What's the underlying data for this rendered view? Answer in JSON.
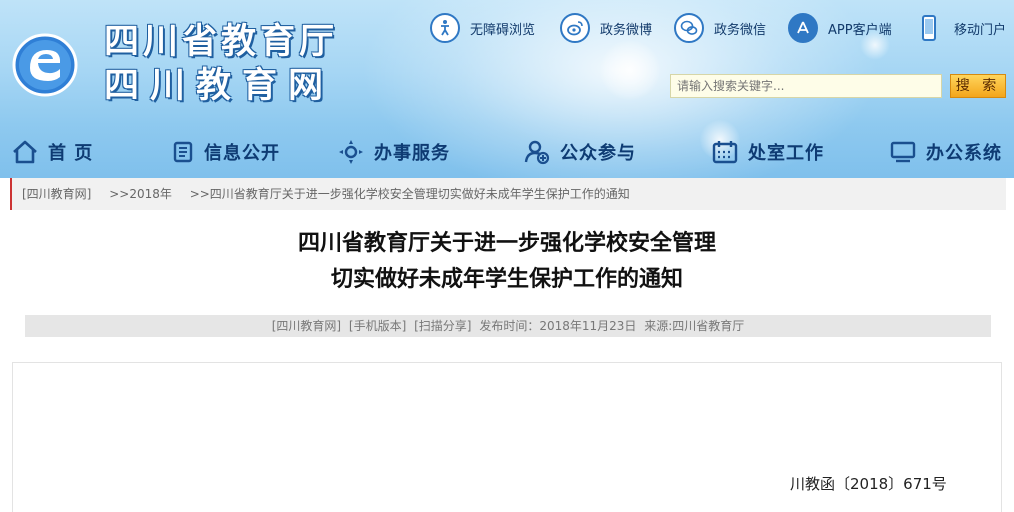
{
  "header": {
    "site_name_line1": "四川省教育厅",
    "site_name_line2": "四川教育网",
    "top_links": [
      {
        "label": "无障碍浏览",
        "icon": "accessibility-icon"
      },
      {
        "label": "政务微博",
        "icon": "weibo-icon"
      },
      {
        "label": "政务微信",
        "icon": "wechat-icon"
      },
      {
        "label": "APP客户端",
        "icon": "app-store-icon"
      },
      {
        "label": "移动门户",
        "icon": "mobile-phone-icon"
      }
    ],
    "search": {
      "placeholder": "请输入搜索关键字...",
      "button_label": "搜 索"
    }
  },
  "nav": [
    {
      "label": "首 页",
      "icon": "home-icon"
    },
    {
      "label": "信息公开",
      "icon": "document-list-icon"
    },
    {
      "label": "办事服务",
      "icon": "service-compass-icon"
    },
    {
      "label": "公众参与",
      "icon": "user-add-icon"
    },
    {
      "label": "处室工作",
      "icon": "calendar-icon"
    },
    {
      "label": "办公系统",
      "icon": "monitor-icon"
    }
  ],
  "breadcrumb": {
    "home": "[四川教育网]",
    "year": ">>2018年",
    "current": ">>四川省教育厅关于进一步强化学校安全管理切实做好未成年学生保护工作的通知"
  },
  "article": {
    "title_line1": "四川省教育厅关于进一步强化学校安全管理",
    "title_line2": "切实做好未成年学生保护工作的通知",
    "meta": {
      "source_site": "[四川教育网]",
      "mobile_version": "[手机版本]",
      "scan_share": "[扫描分享]",
      "publish_time": "发布时间：2018年11月23日",
      "origin": "来源:四川省教育厅"
    },
    "doc_number": "川教函〔2018〕671号"
  },
  "colors": {
    "header_sky": "#8ec9ef",
    "nav_text": "#0e3b73",
    "search_button": "#f3a51b",
    "breadcrumb_accent": "#cc3333"
  }
}
